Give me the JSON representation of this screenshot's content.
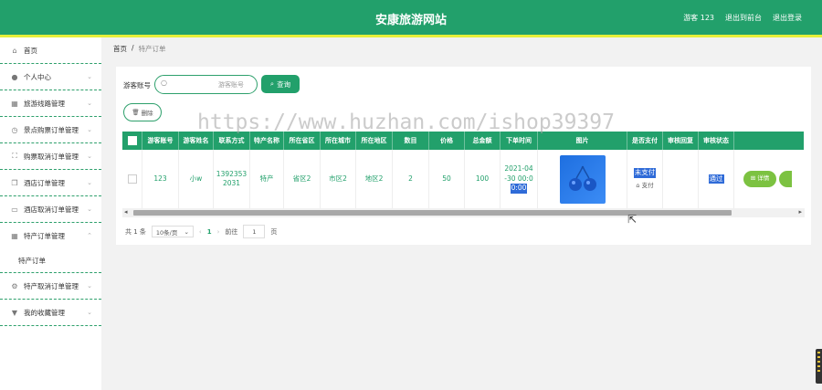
{
  "header": {
    "title": "安康旅游网站",
    "user_label": "游客 123",
    "back_label": "退出到前台",
    "logout_label": "退出登录"
  },
  "sidebar": {
    "items": [
      {
        "label": "首页",
        "icon": "home-icon"
      },
      {
        "label": "个人中心",
        "icon": "user-icon"
      },
      {
        "label": "旅游线路管理",
        "icon": "building-icon"
      },
      {
        "label": "景点购票订单管理",
        "icon": "clock-icon"
      },
      {
        "label": "购票取消订单管理",
        "icon": "expand-icon"
      },
      {
        "label": "酒店订单管理",
        "icon": "copy-icon"
      },
      {
        "label": "酒店取消订单管理",
        "icon": "comment-icon"
      },
      {
        "label": "特产订单管理",
        "icon": "building-icon"
      },
      {
        "label": "特产订单",
        "icon": ""
      },
      {
        "label": "特产取消订单管理",
        "icon": "gear-icon"
      },
      {
        "label": "我的收藏管理",
        "icon": "bookmark-icon"
      }
    ]
  },
  "breadcrumb": {
    "home": "首页",
    "separator": "/",
    "current": "特产订单"
  },
  "search": {
    "label": "游客账号",
    "placeholder": "游客账号",
    "query_button": "查询",
    "delete_button": "删除"
  },
  "table": {
    "columns": [
      "游客账号",
      "游客姓名",
      "联系方式",
      "特产名称",
      "所在省区",
      "所在城市",
      "所在地区",
      "数目",
      "价格",
      "总金额",
      "下单时间",
      "图片",
      "是否支付",
      "审核回复",
      "审核状态"
    ],
    "rows": [
      {
        "account": "123",
        "name": "小w",
        "phone_a": "1392353",
        "phone_b": "2031",
        "product": "特产",
        "province": "省区2",
        "city": "市区2",
        "area": "地区2",
        "count": "2",
        "price": "50",
        "total": "100",
        "time_a": "2021-04",
        "time_b": "-30 00:0",
        "time_c": "0:00",
        "paid": "未支付",
        "pay_action": "支付",
        "review_reply": "",
        "review_status": "通过",
        "detail_button": "详情"
      }
    ]
  },
  "pager": {
    "total": "共 1 条",
    "page_size": "10条/页",
    "current_page": "1",
    "goto_label": "前往",
    "goto_value": "1",
    "page_unit": "页"
  },
  "watermark": "https://www.huzhan.com/ishop39397",
  "colors": {
    "primary": "#22a06b",
    "stripe": "#e6ef3a",
    "button_green": "#7cc241",
    "selection": "#2f6bd8"
  }
}
